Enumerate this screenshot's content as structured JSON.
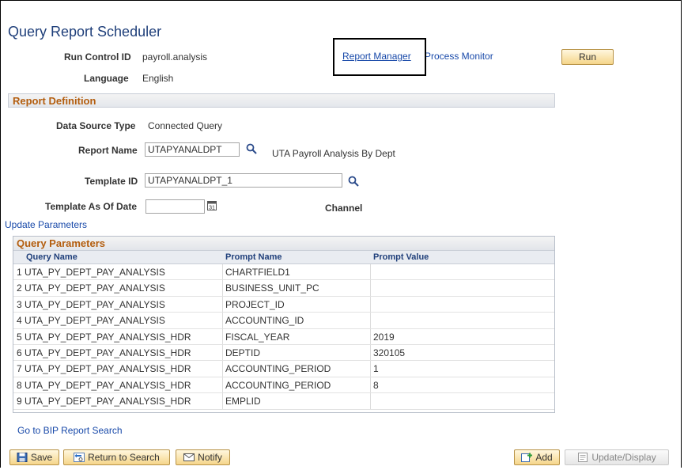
{
  "page": {
    "title": "Query Report Scheduler",
    "run_control_label": "Run Control ID",
    "run_control_value": "payroll.analysis",
    "language_label": "Language",
    "language_value": "English",
    "report_manager_link": "Report Manager",
    "process_monitor_link": "Process Monitor",
    "run_button": "Run"
  },
  "report_definition": {
    "header": "Report Definition",
    "data_source_label": "Data Source Type",
    "data_source_value": "Connected Query",
    "report_name_label": "Report Name",
    "report_name_value": "UTAPYANALDPT",
    "report_description": "UTA Payroll Analysis By Dept",
    "template_id_label": "Template ID",
    "template_id_value": "UTAPYANALDPT_1",
    "template_date_label": "Template As Of Date",
    "template_date_value": "",
    "channel_label": "Channel"
  },
  "update_parameters_link": "Update Parameters",
  "query_parameters": {
    "header": "Query Parameters",
    "columns": [
      "Query Name",
      "Prompt Name",
      "Prompt Value"
    ],
    "rows": [
      {
        "num": "1",
        "query": "UTA_PY_DEPT_PAY_ANALYSIS",
        "prompt": "CHARTFIELD1",
        "value": ""
      },
      {
        "num": "2",
        "query": "UTA_PY_DEPT_PAY_ANALYSIS",
        "prompt": "BUSINESS_UNIT_PC",
        "value": ""
      },
      {
        "num": "3",
        "query": "UTA_PY_DEPT_PAY_ANALYSIS",
        "prompt": "PROJECT_ID",
        "value": ""
      },
      {
        "num": "4",
        "query": "UTA_PY_DEPT_PAY_ANALYSIS",
        "prompt": "ACCOUNTING_ID",
        "value": ""
      },
      {
        "num": "5",
        "query": "UTA_PY_DEPT_PAY_ANALYSIS_HDR",
        "prompt": "FISCAL_YEAR",
        "value": "2019"
      },
      {
        "num": "6",
        "query": "UTA_PY_DEPT_PAY_ANALYSIS_HDR",
        "prompt": "DEPTID",
        "value": "320105"
      },
      {
        "num": "7",
        "query": "UTA_PY_DEPT_PAY_ANALYSIS_HDR",
        "prompt": "ACCOUNTING_PERIOD",
        "value": "1"
      },
      {
        "num": "8",
        "query": "UTA_PY_DEPT_PAY_ANALYSIS_HDR",
        "prompt": "ACCOUNTING_PERIOD",
        "value": "8"
      },
      {
        "num": "9",
        "query": "UTA_PY_DEPT_PAY_ANALYSIS_HDR",
        "prompt": "EMPLID",
        "value": ""
      }
    ]
  },
  "bip_search_link": "Go to BIP Report Search",
  "footer": {
    "save": "Save",
    "return_to_search": "Return to Search",
    "notify": "Notify",
    "add": "Add",
    "update_display": "Update/Display"
  },
  "icons": {
    "lookup": "magnifier-icon",
    "calendar": "calendar-icon",
    "save": "save-icon",
    "return": "return-icon",
    "notify": "notify-icon",
    "add": "add-icon",
    "update": "update-icon"
  }
}
